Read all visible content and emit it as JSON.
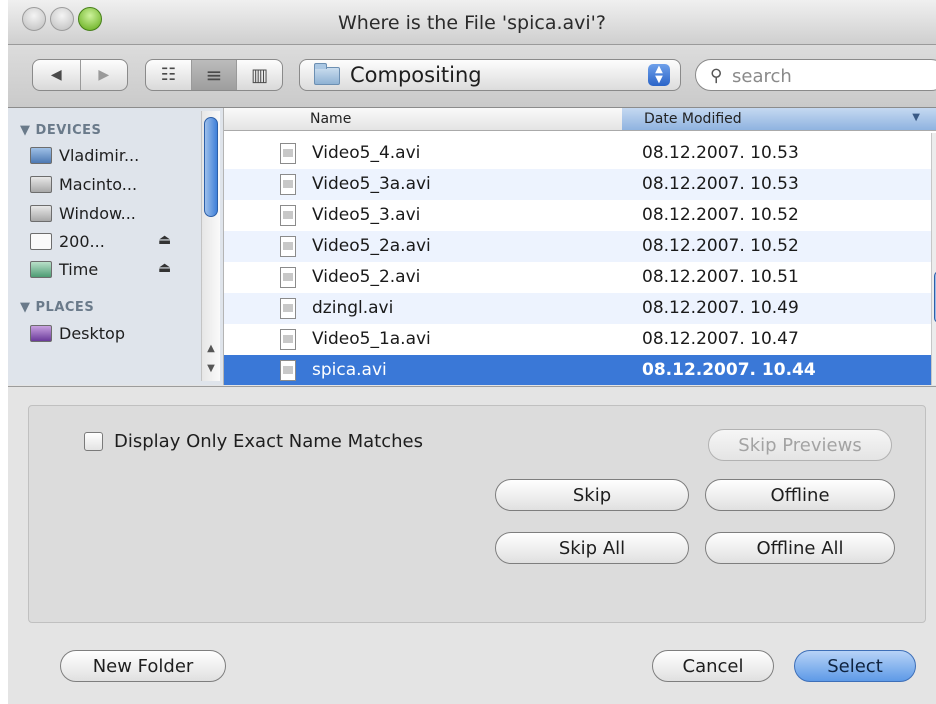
{
  "window": {
    "title": "Where is the File 'spica.avi'?"
  },
  "toolbar": {
    "back_icon": "◀",
    "forward_icon": "▶",
    "view_icon_glyph": "☷",
    "view_list_glyph": "≡",
    "view_column_glyph": "▥",
    "location": "Compositing",
    "search_placeholder": "search",
    "search_icon": "🔍"
  },
  "sidebar": {
    "devices_header": "▼ DEVICES",
    "places_header": "▼ PLACES",
    "devices": [
      {
        "label": "Vladimir...",
        "icon": "computer-icon"
      },
      {
        "label": "Macinto...",
        "icon": "hard-drive-icon"
      },
      {
        "label": "Window...",
        "icon": "hard-drive-icon"
      },
      {
        "label": "200...",
        "icon": "disk-icon",
        "eject": "⏏"
      },
      {
        "label": "Time",
        "icon": "time-machine-icon",
        "eject": "⏏"
      }
    ],
    "places": [
      {
        "label": "Desktop",
        "icon": "desktop-icon"
      }
    ]
  },
  "file_list": {
    "columns": {
      "name": "Name",
      "date": "Date Modified",
      "sort_glyph": "▼"
    },
    "rows": [
      {
        "name": "Video5_4.avi",
        "date": "08.12.2007. 10.53"
      },
      {
        "name": "Video5_3a.avi",
        "date": "08.12.2007. 10.53"
      },
      {
        "name": "Video5_3.avi",
        "date": "08.12.2007. 10.52"
      },
      {
        "name": "Video5_2a.avi",
        "date": "08.12.2007. 10.52"
      },
      {
        "name": "Video5_2.avi",
        "date": "08.12.2007. 10.51"
      },
      {
        "name": "dzingl.avi",
        "date": "08.12.2007. 10.49"
      },
      {
        "name": "Video5_1a.avi",
        "date": "08.12.2007. 10.47"
      },
      {
        "name": "spica.avi",
        "date": "08.12.2007. 10.44",
        "selected": true
      }
    ]
  },
  "options": {
    "exact_match_label": "Display Only Exact Name Matches",
    "exact_match_checked": false,
    "skip_previews": "Skip Previews",
    "skip": "Skip",
    "offline": "Offline",
    "skip_all": "Skip All",
    "offline_all": "Offline All"
  },
  "footer": {
    "new_folder": "New Folder",
    "cancel": "Cancel",
    "select": "Select"
  },
  "colors": {
    "selection": "#3a78d7",
    "default_button": "#5e9ae7",
    "sidebar_bg": "#dfe4eb"
  }
}
